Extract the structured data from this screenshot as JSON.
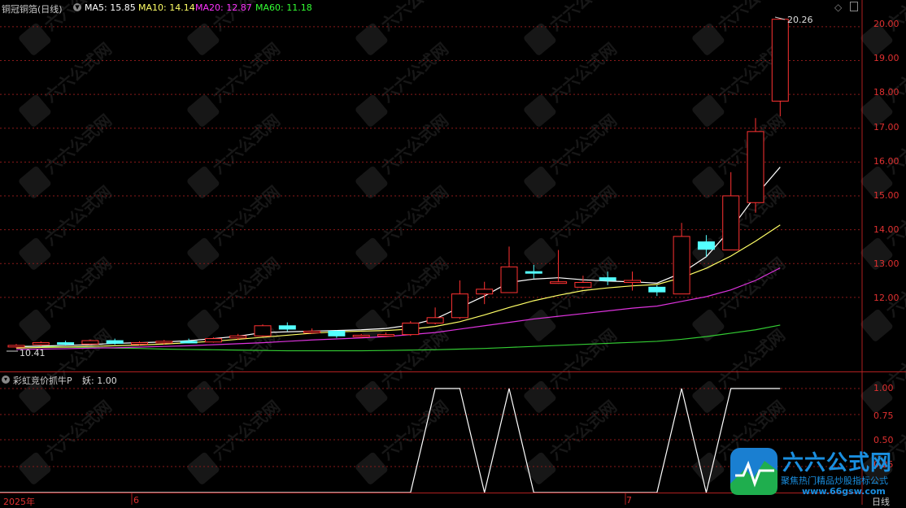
{
  "header": {
    "stock_name": "铜冠铜箔(日线)",
    "ma5": "MA5: 15.85",
    "ma10": "MA10: 14.14",
    "ma20": "MA20: 12.87",
    "ma60": "MA60: 11.18",
    "colors": {
      "ma5": "#ffffff",
      "ma10": "#ffff66",
      "ma20": "#ff33ff",
      "ma60": "#33ff33"
    }
  },
  "price_axis": [
    "20.00",
    "19.00",
    "18.00",
    "17.00",
    "16.00",
    "15.00",
    "14.00",
    "13.00",
    "12.00"
  ],
  "max_label": "20.26",
  "min_label": "10.41",
  "indicator": {
    "title": "彩虹竞价抓牛P",
    "value_label": "妖: 1.00",
    "axis": [
      "1.00",
      "0.75",
      "0.50",
      "0.25"
    ]
  },
  "time_axis": {
    "start": "2025年",
    "m6": "6",
    "m7": "7",
    "period": "日线"
  },
  "watermark": {
    "name": "六六公式网",
    "slogan": "聚焦热门精品炒股指标公式",
    "url": "www.66gsw.com"
  },
  "chart_data": {
    "type": "candlestick",
    "ylim": [
      10.2,
      20.5
    ],
    "candles": [
      {
        "o": 10.55,
        "h": 10.62,
        "l": 10.5,
        "c": 10.58,
        "up": true
      },
      {
        "o": 10.6,
        "h": 10.7,
        "l": 10.56,
        "c": 10.66,
        "up": true
      },
      {
        "o": 10.66,
        "h": 10.72,
        "l": 10.58,
        "c": 10.62,
        "up": false
      },
      {
        "o": 10.62,
        "h": 10.75,
        "l": 10.6,
        "c": 10.72,
        "up": true
      },
      {
        "o": 10.72,
        "h": 10.78,
        "l": 10.6,
        "c": 10.64,
        "up": false
      },
      {
        "o": 10.64,
        "h": 10.7,
        "l": 10.58,
        "c": 10.66,
        "up": true
      },
      {
        "o": 10.66,
        "h": 10.74,
        "l": 10.6,
        "c": 10.7,
        "up": true
      },
      {
        "o": 10.7,
        "h": 10.78,
        "l": 10.64,
        "c": 10.68,
        "up": false
      },
      {
        "o": 10.68,
        "h": 10.82,
        "l": 10.66,
        "c": 10.78,
        "up": true
      },
      {
        "o": 10.8,
        "h": 10.92,
        "l": 10.74,
        "c": 10.86,
        "up": true
      },
      {
        "o": 10.86,
        "h": 11.2,
        "l": 10.84,
        "c": 11.16,
        "up": true
      },
      {
        "o": 11.16,
        "h": 11.26,
        "l": 11.0,
        "c": 11.06,
        "up": false
      },
      {
        "o": 11.0,
        "h": 11.08,
        "l": 10.92,
        "c": 11.0,
        "up": true
      },
      {
        "o": 11.0,
        "h": 11.02,
        "l": 10.8,
        "c": 10.86,
        "up": false
      },
      {
        "o": 10.86,
        "h": 10.92,
        "l": 10.8,
        "c": 10.88,
        "up": true
      },
      {
        "o": 10.88,
        "h": 10.96,
        "l": 10.82,
        "c": 10.9,
        "up": true
      },
      {
        "o": 10.9,
        "h": 11.3,
        "l": 10.86,
        "c": 11.24,
        "up": true
      },
      {
        "o": 11.24,
        "h": 11.7,
        "l": 11.2,
        "c": 11.4,
        "up": true
      },
      {
        "o": 11.4,
        "h": 12.5,
        "l": 11.36,
        "c": 12.1,
        "up": true
      },
      {
        "o": 12.1,
        "h": 12.46,
        "l": 11.8,
        "c": 12.24,
        "up": true
      },
      {
        "o": 12.14,
        "h": 13.5,
        "l": 12.14,
        "c": 12.9,
        "up": true
      },
      {
        "o": 12.72,
        "h": 12.96,
        "l": 12.56,
        "c": 12.76,
        "up": false
      },
      {
        "o": 12.44,
        "h": 13.4,
        "l": 12.4,
        "c": 12.46,
        "up": true
      },
      {
        "o": 12.3,
        "h": 12.64,
        "l": 12.26,
        "c": 12.44,
        "up": true
      },
      {
        "o": 12.58,
        "h": 12.76,
        "l": 12.36,
        "c": 12.5,
        "up": false
      },
      {
        "o": 12.44,
        "h": 12.76,
        "l": 12.2,
        "c": 12.5,
        "up": true
      },
      {
        "o": 12.3,
        "h": 12.36,
        "l": 12.04,
        "c": 12.16,
        "up": false
      },
      {
        "o": 12.1,
        "h": 14.2,
        "l": 12.1,
        "c": 13.8,
        "up": true
      },
      {
        "o": 13.64,
        "h": 13.84,
        "l": 13.2,
        "c": 13.42,
        "up": false
      },
      {
        "o": 13.4,
        "h": 15.7,
        "l": 13.4,
        "c": 15.0,
        "up": true
      },
      {
        "o": 14.8,
        "h": 17.3,
        "l": 14.5,
        "c": 16.9,
        "up": true
      },
      {
        "o": 17.8,
        "h": 20.26,
        "l": 17.35,
        "c": 20.22,
        "up": true
      }
    ],
    "ma5": [
      10.54,
      10.56,
      10.58,
      10.6,
      10.64,
      10.66,
      10.68,
      10.72,
      10.78,
      10.85,
      10.96,
      10.98,
      11.0,
      11.02,
      11.04,
      11.08,
      11.18,
      11.36,
      11.7,
      12.04,
      12.44,
      12.54,
      12.58,
      12.52,
      12.48,
      12.46,
      12.42,
      12.72,
      13.2,
      14.02,
      15.0,
      15.85
    ],
    "ma10": [
      10.5,
      10.52,
      10.53,
      10.55,
      10.57,
      10.59,
      10.62,
      10.66,
      10.7,
      10.76,
      10.82,
      10.88,
      10.94,
      10.98,
      11.0,
      11.02,
      11.06,
      11.14,
      11.28,
      11.48,
      11.7,
      11.9,
      12.06,
      12.2,
      12.28,
      12.34,
      12.38,
      12.58,
      12.86,
      13.22,
      13.66,
      14.14
    ],
    "ma20": [
      10.46,
      10.47,
      10.48,
      10.5,
      10.51,
      10.53,
      10.55,
      10.57,
      10.6,
      10.63,
      10.66,
      10.7,
      10.74,
      10.77,
      10.8,
      10.84,
      10.9,
      10.96,
      11.06,
      11.16,
      11.26,
      11.36,
      11.44,
      11.52,
      11.6,
      11.68,
      11.74,
      11.88,
      12.02,
      12.22,
      12.5,
      12.87
    ],
    "ma60": [
      10.56,
      10.55,
      10.53,
      10.52,
      10.5,
      10.49,
      10.47,
      10.46,
      10.45,
      10.44,
      10.43,
      10.42,
      10.42,
      10.42,
      10.42,
      10.43,
      10.44,
      10.45,
      10.47,
      10.49,
      10.52,
      10.55,
      10.58,
      10.61,
      10.64,
      10.67,
      10.7,
      10.76,
      10.84,
      10.94,
      11.04,
      11.18
    ],
    "indicator_ylim": [
      0,
      1.0
    ],
    "indicator_values": [
      0,
      0,
      0,
      0,
      0,
      0,
      0,
      0,
      0,
      0,
      0,
      0,
      0,
      0,
      0,
      0,
      0,
      1,
      1,
      0,
      1,
      0,
      0,
      0,
      0,
      0,
      0,
      1,
      0,
      1,
      1,
      1
    ]
  }
}
